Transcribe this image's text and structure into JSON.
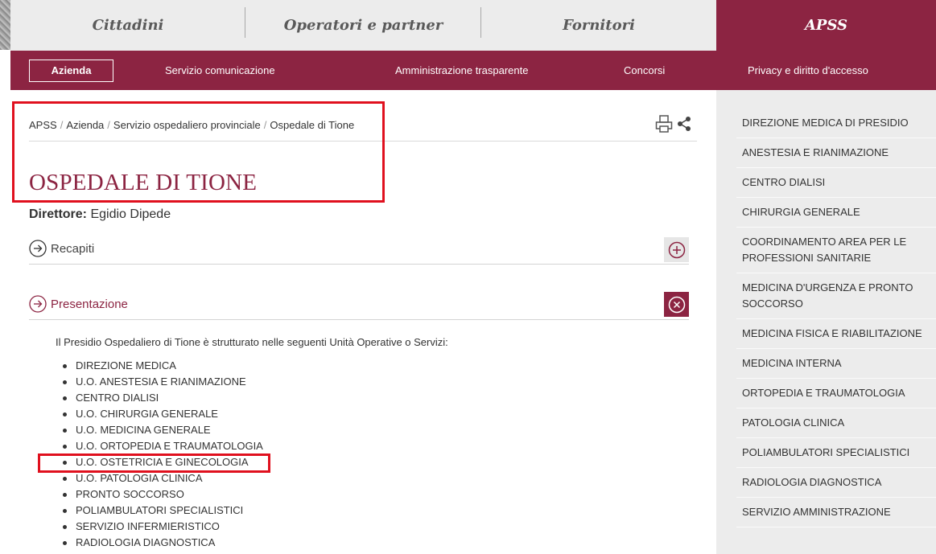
{
  "topnav": {
    "tabs": [
      {
        "label": "Cittadini"
      },
      {
        "label": "Operatori e partner"
      },
      {
        "label": "Fornitori"
      },
      {
        "label": "APSS",
        "active": true
      }
    ]
  },
  "subnav": {
    "items": [
      {
        "label": "Azienda",
        "active": true
      },
      {
        "label": "Servizio comunicazione"
      },
      {
        "label": "Amministrazione trasparente"
      },
      {
        "label": "Concorsi"
      },
      {
        "label": "Privacy e diritto d'accesso"
      }
    ]
  },
  "breadcrumb": {
    "items": [
      "APSS",
      "Azienda",
      "Servizio ospedaliero provinciale",
      "Ospedale di Tione"
    ],
    "separator": "/"
  },
  "tools": {
    "print_icon": "print-icon",
    "share_icon": "share-icon"
  },
  "page": {
    "title": "OSPEDALE DI TIONE",
    "director_label": "Direttore:",
    "director_name": "Egidio Dipede"
  },
  "accordions": {
    "recapiti": {
      "label": "Recapiti",
      "expanded": false,
      "icon": "plus-icon"
    },
    "presentazione": {
      "label": "Presentazione",
      "expanded": true,
      "icon": "close-icon"
    }
  },
  "presentazione": {
    "intro": "Il Presidio Ospedaliero di Tione è strutturato nelle seguenti Unità Operative o Servizi:",
    "units": [
      "DIREZIONE MEDICA",
      "U.O. ANESTESIA E RIANIMAZIONE",
      "CENTRO DIALISI",
      "U.O. CHIRURGIA GENERALE",
      "U.O. MEDICINA GENERALE",
      "U.O. ORTOPEDIA E TRAUMATOLOGIA",
      "U.O. OSTETRICIA E GINECOLOGIA",
      "U.O. PATOLOGIA CLINICA",
      "PRONTO SOCCORSO",
      "POLIAMBULATORI SPECIALISTICI",
      "SERVIZIO INFERMIERISTICO",
      "RADIOLOGIA DIAGNOSTICA"
    ]
  },
  "sidebar": {
    "items": [
      "DIREZIONE MEDICA DI PRESIDIO",
      "ANESTESIA E RIANIMAZIONE",
      "CENTRO DIALISI",
      "CHIRURGIA GENERALE",
      "COORDINAMENTO AREA PER LE PROFESSIONI SANITARIE",
      "MEDICINA D'URGENZA E PRONTO SOCCORSO",
      "MEDICINA FISICA E RIABILITAZIONE",
      "MEDICINA INTERNA",
      "ORTOPEDIA E TRAUMATOLOGIA",
      "PATOLOGIA CLINICA",
      "POLIAMBULATORI SPECIALISTICI",
      "RADIOLOGIA DIAGNOSTICA",
      "SERVIZIO AMMINISTRAZIONE"
    ]
  },
  "colors": {
    "brand": "#8c2442",
    "topnav_bg": "#ececec",
    "sidebar_bg": "#ececec",
    "annotation": "#e0101e"
  }
}
